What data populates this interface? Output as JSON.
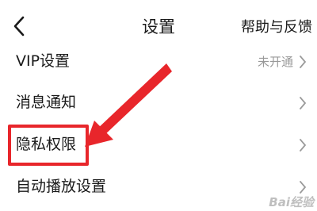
{
  "header": {
    "back_icon": "chevron-left-icon",
    "title": "设置",
    "help_label": "帮助与反馈"
  },
  "settings": [
    {
      "label": "VIP设置",
      "value": "未开通"
    },
    {
      "label": "消息通知",
      "value": ""
    },
    {
      "label": "隐私权限",
      "value": "",
      "highlighted": true
    },
    {
      "label": "自动播放设置",
      "value": ""
    }
  ],
  "annotation": {
    "color": "#e8262b",
    "target": "隐私权限"
  },
  "watermark": "Bai经验"
}
